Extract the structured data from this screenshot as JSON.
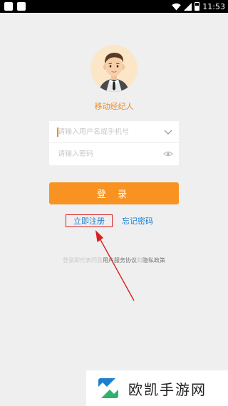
{
  "status_bar": {
    "time": "11:53",
    "wifi_icon": "wifi-icon",
    "signal_icon": "signal-icon",
    "battery_icon": "battery-icon"
  },
  "app": {
    "name": "移动经纪人",
    "avatar_icon": "agent-avatar"
  },
  "login_form": {
    "account_placeholder": "请输入用户名或手机号",
    "password_placeholder": "请输入密码",
    "dropdown_icon": "chevron-down-icon",
    "visibility_icon": "eye-icon",
    "login_button_label": "登 录",
    "register_label": "立即注册",
    "forgot_password_label": "忘记密码"
  },
  "agreement": {
    "prefix": "登录即代表同意",
    "user_agreement": "用户服务协议",
    "and": "和",
    "privacy_policy": "隐私政策"
  },
  "colors": {
    "accent": "#f89321",
    "link": "#1a7fd6",
    "highlight_box": "#d81e1e",
    "background": "#efefef"
  },
  "watermark": {
    "text": "欧凯手游网",
    "logo_icon": "okhand-logo"
  }
}
